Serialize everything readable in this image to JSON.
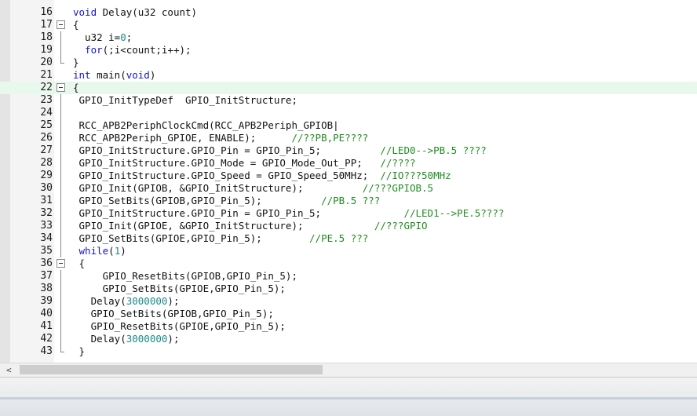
{
  "editor": {
    "lines": [
      {
        "num": "16",
        "fold": "none",
        "parts": [
          {
            "t": "void",
            "c": "kw"
          },
          {
            "t": " Delay(u32 count)",
            "c": ""
          }
        ]
      },
      {
        "num": "17",
        "fold": "open",
        "parts": [
          {
            "t": "{",
            "c": ""
          }
        ]
      },
      {
        "num": "18",
        "fold": "line",
        "parts": [
          {
            "t": "  u32 i=",
            "c": ""
          },
          {
            "t": "0",
            "c": "nm"
          },
          {
            "t": ";",
            "c": ""
          }
        ]
      },
      {
        "num": "19",
        "fold": "line",
        "parts": [
          {
            "t": "  ",
            "c": ""
          },
          {
            "t": "for",
            "c": "kw"
          },
          {
            "t": "(;i<count;i++);",
            "c": ""
          }
        ]
      },
      {
        "num": "20",
        "fold": "end",
        "parts": [
          {
            "t": "}",
            "c": ""
          }
        ]
      },
      {
        "num": "21",
        "fold": "none",
        "parts": [
          {
            "t": "int",
            "c": "kw"
          },
          {
            "t": " main(",
            "c": ""
          },
          {
            "t": "void",
            "c": "kw"
          },
          {
            "t": ")",
            "c": ""
          }
        ]
      },
      {
        "num": "22",
        "fold": "open",
        "highlight": true,
        "parts": [
          {
            "t": "{",
            "c": ""
          }
        ]
      },
      {
        "num": "23",
        "fold": "line",
        "parts": [
          {
            "t": " GPIO_InitTypeDef  GPIO_InitStructure;",
            "c": ""
          }
        ]
      },
      {
        "num": "24",
        "fold": "line",
        "parts": [
          {
            "t": "",
            "c": ""
          }
        ]
      },
      {
        "num": "25",
        "fold": "line",
        "parts": [
          {
            "t": " RCC_APB2PeriphClockCmd(RCC_APB2Periph_GPIOB|",
            "c": ""
          }
        ]
      },
      {
        "num": "26",
        "fold": "line",
        "parts": [
          {
            "t": " RCC_APB2Periph_GPIOE, ENABLE);      ",
            "c": ""
          },
          {
            "t": "//??PB,PE????",
            "c": "cm"
          }
        ]
      },
      {
        "num": "27",
        "fold": "line",
        "parts": [
          {
            "t": " GPIO_InitStructure.GPIO_Pin = GPIO_Pin_5;          ",
            "c": ""
          },
          {
            "t": "//LED0-->PB.5 ????",
            "c": "cm"
          }
        ]
      },
      {
        "num": "28",
        "fold": "line",
        "parts": [
          {
            "t": " GPIO_InitStructure.GPIO_Mode = GPIO_Mode_Out_PP;   ",
            "c": ""
          },
          {
            "t": "//????",
            "c": "cm"
          }
        ]
      },
      {
        "num": "29",
        "fold": "line",
        "parts": [
          {
            "t": " GPIO_InitStructure.GPIO_Speed = GPIO_Speed_50MHz;  ",
            "c": ""
          },
          {
            "t": "//IO???50MHz",
            "c": "cm"
          }
        ]
      },
      {
        "num": "30",
        "fold": "line",
        "parts": [
          {
            "t": " GPIO_Init(GPIOB, &GPIO_InitStructure);          ",
            "c": ""
          },
          {
            "t": "//???GPIOB.5",
            "c": "cm"
          }
        ]
      },
      {
        "num": "31",
        "fold": "line",
        "parts": [
          {
            "t": " GPIO_SetBits(GPIOB,GPIO_Pin_5);          ",
            "c": ""
          },
          {
            "t": "//PB.5 ???",
            "c": "cm"
          }
        ]
      },
      {
        "num": "32",
        "fold": "line",
        "parts": [
          {
            "t": " GPIO_InitStructure.GPIO_Pin = GPIO_Pin_5;              ",
            "c": ""
          },
          {
            "t": "//LED1-->PE.5????",
            "c": "cm"
          }
        ]
      },
      {
        "num": "33",
        "fold": "line",
        "parts": [
          {
            "t": " GPIO_Init(GPIOE, &GPIO_InitStructure);            ",
            "c": ""
          },
          {
            "t": "//???GPIO",
            "c": "cm"
          }
        ]
      },
      {
        "num": "34",
        "fold": "line",
        "parts": [
          {
            "t": " GPIO_SetBits(GPIOE,GPIO_Pin_5);        ",
            "c": ""
          },
          {
            "t": "//PE.5 ???",
            "c": "cm"
          }
        ]
      },
      {
        "num": "35",
        "fold": "line",
        "parts": [
          {
            "t": " ",
            "c": ""
          },
          {
            "t": "while",
            "c": "kw"
          },
          {
            "t": "(",
            "c": ""
          },
          {
            "t": "1",
            "c": "nm"
          },
          {
            "t": ")",
            "c": ""
          }
        ]
      },
      {
        "num": "36",
        "fold": "open",
        "parts": [
          {
            "t": " {",
            "c": ""
          }
        ]
      },
      {
        "num": "37",
        "fold": "line",
        "parts": [
          {
            "t": "     GPIO_ResetBits(GPIOB,GPIO_Pin_5);",
            "c": ""
          }
        ]
      },
      {
        "num": "38",
        "fold": "line",
        "parts": [
          {
            "t": "     GPIO_SetBits(GPIOE,GPIO_Pin_5);",
            "c": ""
          }
        ]
      },
      {
        "num": "39",
        "fold": "line",
        "parts": [
          {
            "t": "   Delay(",
            "c": ""
          },
          {
            "t": "3000000",
            "c": "nm"
          },
          {
            "t": ");",
            "c": ""
          }
        ]
      },
      {
        "num": "40",
        "fold": "line",
        "parts": [
          {
            "t": "   GPIO_SetBits(GPIOB,GPIO_Pin_5);",
            "c": ""
          }
        ]
      },
      {
        "num": "41",
        "fold": "line",
        "parts": [
          {
            "t": "   GPIO_ResetBits(GPIOE,GPIO_Pin_5);",
            "c": ""
          }
        ]
      },
      {
        "num": "42",
        "fold": "line",
        "parts": [
          {
            "t": "   Delay(",
            "c": ""
          },
          {
            "t": "3000000",
            "c": "nm"
          },
          {
            "t": ");",
            "c": ""
          }
        ]
      },
      {
        "num": "43",
        "fold": "end",
        "parts": [
          {
            "t": " }",
            "c": ""
          }
        ]
      }
    ]
  },
  "scrollbar": {
    "left_arrow": "<"
  }
}
